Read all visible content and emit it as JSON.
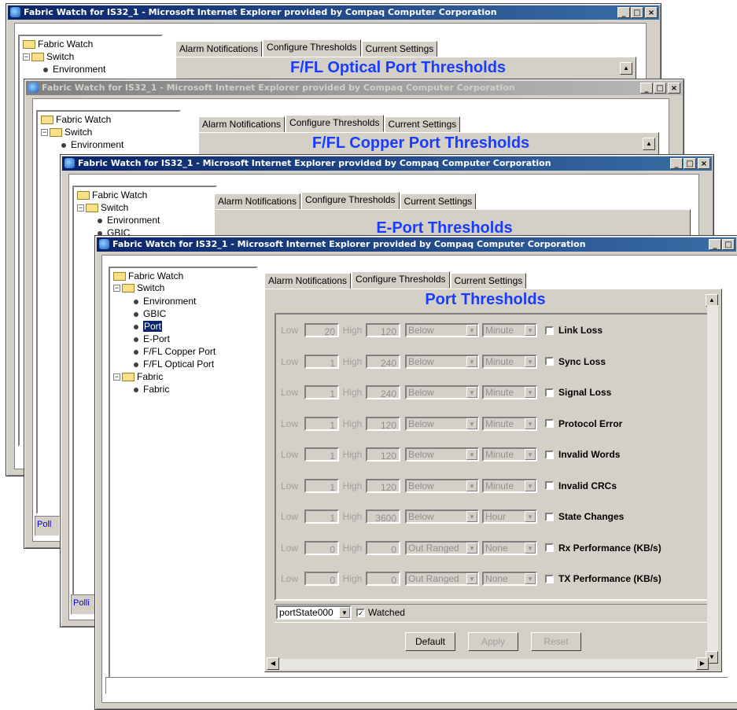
{
  "windows": [
    {
      "title": "Fabric Watch for IS32_1 - Microsoft Internet Explorer provided by Compaq Computer Corporation",
      "tabs": [
        "Alarm Notifications",
        "Configure Thresholds",
        "Current Settings"
      ],
      "panel_title": "F/FL Optical Port Thresholds",
      "tree": [
        "Fabric Watch",
        "Switch",
        "Environment"
      ]
    },
    {
      "title": "Fabric Watch for IS32_1 - Microsoft Internet Explorer provided by Compaq Computer Corporation",
      "tabs": [
        "Alarm Notifications",
        "Configure Thresholds",
        "Current Settings"
      ],
      "panel_title": "F/FL Copper Port Thresholds",
      "tree": [
        "Fabric Watch",
        "Switch",
        "Environment"
      ],
      "status_text": "Poll"
    },
    {
      "title": "Fabric Watch for IS32_1 - Microsoft Internet Explorer provided by Compaq Computer Corporation",
      "tabs": [
        "Alarm Notifications",
        "Configure Thresholds",
        "Current Settings"
      ],
      "panel_title": "E-Port Thresholds",
      "tree": [
        "Fabric Watch",
        "Switch",
        "Environment",
        "GBIC"
      ],
      "status_text": "Polli"
    }
  ],
  "main": {
    "title": "Fabric Watch for IS32_1 - Microsoft Internet Explorer provided by Compaq Computer Corporation",
    "tabs": [
      "Alarm Notifications",
      "Configure Thresholds",
      "Current Settings"
    ],
    "panel_title": "Port Thresholds",
    "tree": {
      "root": "Fabric Watch",
      "switch": "Switch",
      "switch_items": [
        "Environment",
        "GBIC",
        "Port",
        "E-Port",
        "F/FL Copper Port",
        "F/FL Optical Port"
      ],
      "selected": "Port",
      "fabric": "Fabric",
      "fabric_items": [
        "Fabric"
      ]
    },
    "low_label": "Low",
    "high_label": "High",
    "rows": [
      {
        "low": "20",
        "high": "120",
        "trigger": "Below",
        "unit": "Minute",
        "metric": "Link Loss"
      },
      {
        "low": "1",
        "high": "240",
        "trigger": "Below",
        "unit": "Minute",
        "metric": "Sync Loss"
      },
      {
        "low": "1",
        "high": "240",
        "trigger": "Below",
        "unit": "Minute",
        "metric": "Signal Loss"
      },
      {
        "low": "1",
        "high": "120",
        "trigger": "Below",
        "unit": "Minute",
        "metric": "Protocol Error"
      },
      {
        "low": "1",
        "high": "120",
        "trigger": "Below",
        "unit": "Minute",
        "metric": "Invalid Words"
      },
      {
        "low": "1",
        "high": "120",
        "trigger": "Below",
        "unit": "Minute",
        "metric": "Invalid CRCs"
      },
      {
        "low": "1",
        "high": "3600",
        "trigger": "Below",
        "unit": "Hour",
        "metric": "State Changes"
      },
      {
        "low": "0",
        "high": "0",
        "trigger": "Out Ranged",
        "unit": "None",
        "metric": "Rx Performance (KB/s)"
      },
      {
        "low": "0",
        "high": "0",
        "trigger": "Out Ranged",
        "unit": "None",
        "metric": "TX Performance (KB/s)"
      }
    ],
    "port_select": "portState000",
    "watched_label": "Watched",
    "watched_checked": true,
    "buttons": {
      "default": "Default",
      "apply": "Apply",
      "reset": "Reset"
    }
  },
  "colors": {
    "title_active": "#0a246a",
    "heading_blue": "#1a3cff",
    "face": "#d4d0c8"
  }
}
